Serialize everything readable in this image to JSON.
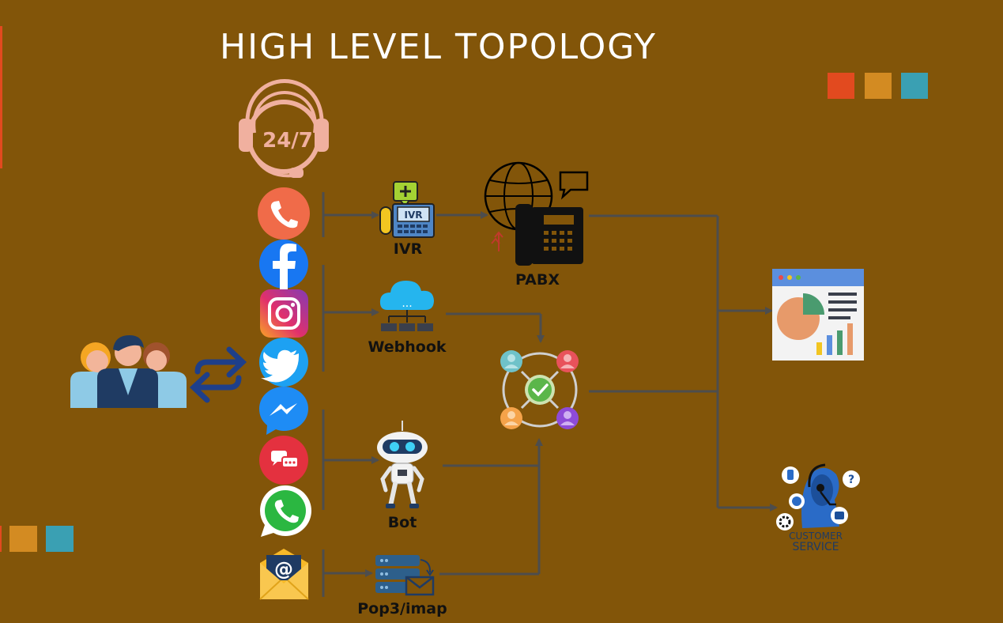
{
  "title": "HIGH LEVEL TOPOLOGY",
  "colors": {
    "background": "#825509",
    "connector": "#4d4d4d",
    "accent_red": "#e24a1f",
    "accent_orange": "#d38b22",
    "accent_teal": "#3aa0b3",
    "headset": "#f0b09f"
  },
  "support_badge": {
    "text": "24/7",
    "icon": "headset-247-icon"
  },
  "channels": [
    {
      "name": "phone",
      "icon": "phone-icon",
      "color": "#f06b49"
    },
    {
      "name": "facebook",
      "icon": "facebook-icon",
      "color": "#1877f2"
    },
    {
      "name": "instagram",
      "icon": "instagram-icon",
      "color": "#d62f79"
    },
    {
      "name": "twitter",
      "icon": "twitter-icon",
      "color": "#1da1f2"
    },
    {
      "name": "messenger",
      "icon": "messenger-icon",
      "color": "#1e8cf5"
    },
    {
      "name": "chat",
      "icon": "chat-icon",
      "color": "#e4313f"
    },
    {
      "name": "whatsapp",
      "icon": "whatsapp-icon",
      "color": "#2bb741"
    },
    {
      "name": "email",
      "icon": "email-icon",
      "color": "#f7b928"
    }
  ],
  "nodes": {
    "ivr": {
      "label": "IVR",
      "badge": "IVR"
    },
    "pabx": {
      "label": "PABX"
    },
    "webhook": {
      "label": "Webhook"
    },
    "bot": {
      "label": "Bot"
    },
    "pop3": {
      "label": "Pop3/imap"
    },
    "routing_hub": {
      "icon": "agent-routing-hub-icon"
    },
    "dashboard": {
      "icon": "analytics-dashboard-icon"
    },
    "customer_service": {
      "text_line1": "CUSTOMER",
      "text_line2": "SERVICE"
    }
  }
}
